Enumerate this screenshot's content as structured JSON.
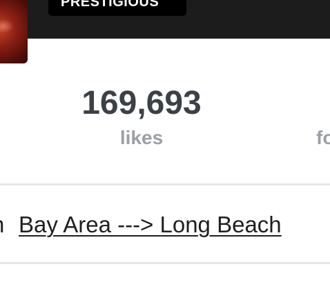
{
  "header": {
    "badge_label": "PRESTIGIOUS"
  },
  "stats": {
    "likes": {
      "value": "169,693",
      "label": "likes"
    },
    "followers": {
      "label": "fo"
    }
  },
  "bio": {
    "prefix": "n",
    "link_text": "Bay Area ---> Long Beach"
  },
  "colors": {
    "top_bar": "#1c1c1c",
    "stat_value": "#3b4147",
    "stat_label": "#9aa0a6",
    "divider": "#e6e6e9"
  }
}
